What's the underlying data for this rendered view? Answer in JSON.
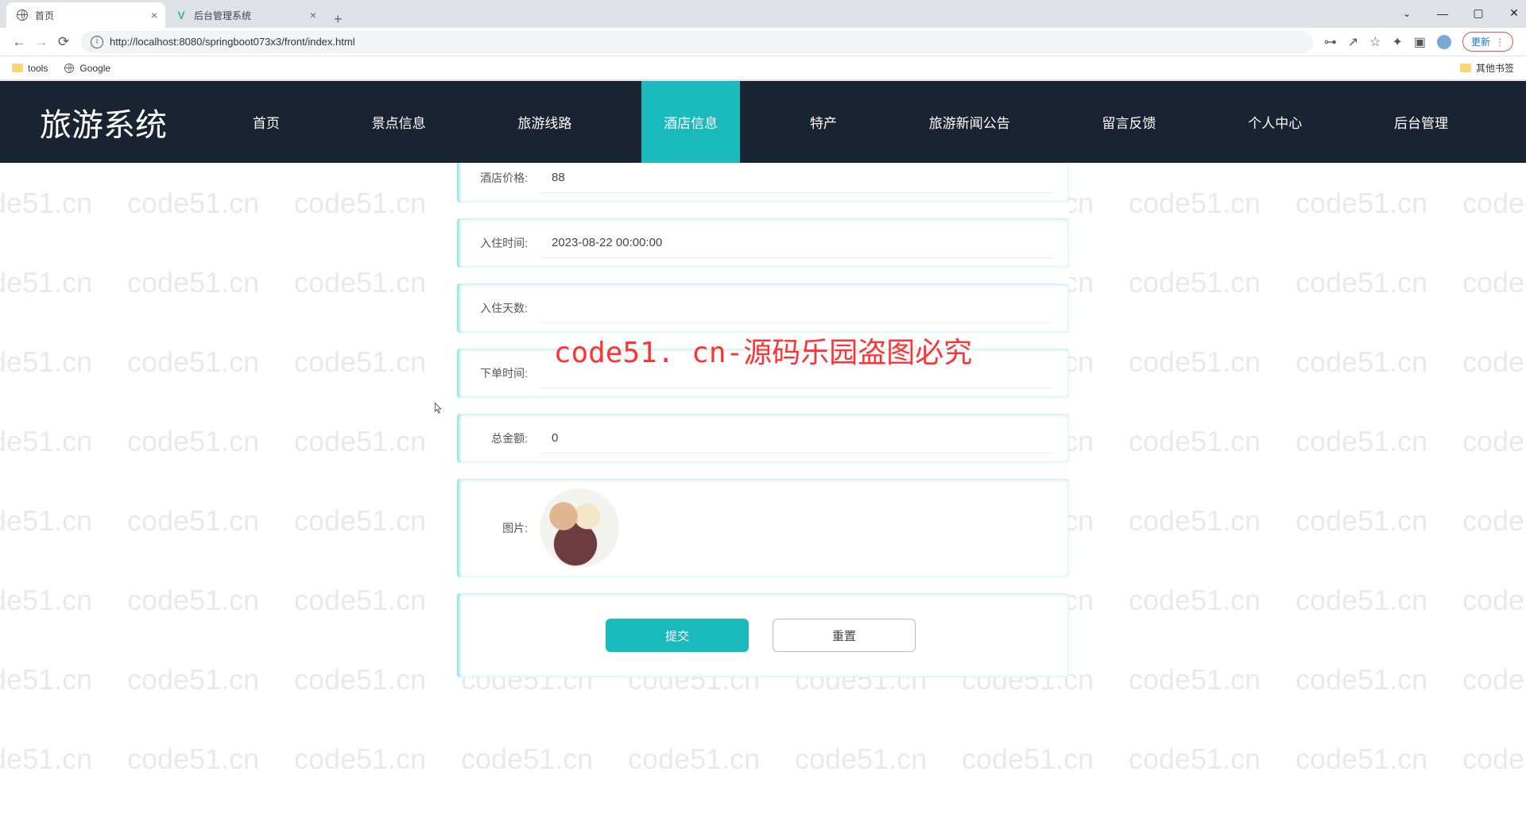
{
  "browser": {
    "tabs": [
      {
        "title": "首页",
        "icon": "globe"
      },
      {
        "title": "后台管理系统",
        "icon": "vue"
      }
    ],
    "url": "http://localhost:8080/springboot073x3/front/index.html",
    "update_label": "更新",
    "bookmarks": [
      {
        "label": "tools",
        "icon": "folder"
      },
      {
        "label": "Google",
        "icon": "globe"
      }
    ],
    "other_bookmarks": "其他书签"
  },
  "nav": {
    "logo": "旅游系统",
    "items": [
      "首页",
      "景点信息",
      "旅游线路",
      "酒店信息",
      "特产",
      "旅游新闻公告",
      "留言反馈",
      "个人中心",
      "后台管理"
    ],
    "active_index": 3
  },
  "form": {
    "price_label": "酒店价格:",
    "price_value": "88",
    "checkin_label": "入住时间:",
    "checkin_value": "2023-08-22 00:00:00",
    "days_label": "入住天数:",
    "days_value": "",
    "order_label": "下单时间:",
    "order_value": "",
    "total_label": "总金额:",
    "total_value": "0",
    "image_label": "图片:",
    "submit": "提交",
    "reset": "重置"
  },
  "watermarks": {
    "bg_text": "code51.cn",
    "central": "code51. cn-源码乐园盗图必究"
  }
}
